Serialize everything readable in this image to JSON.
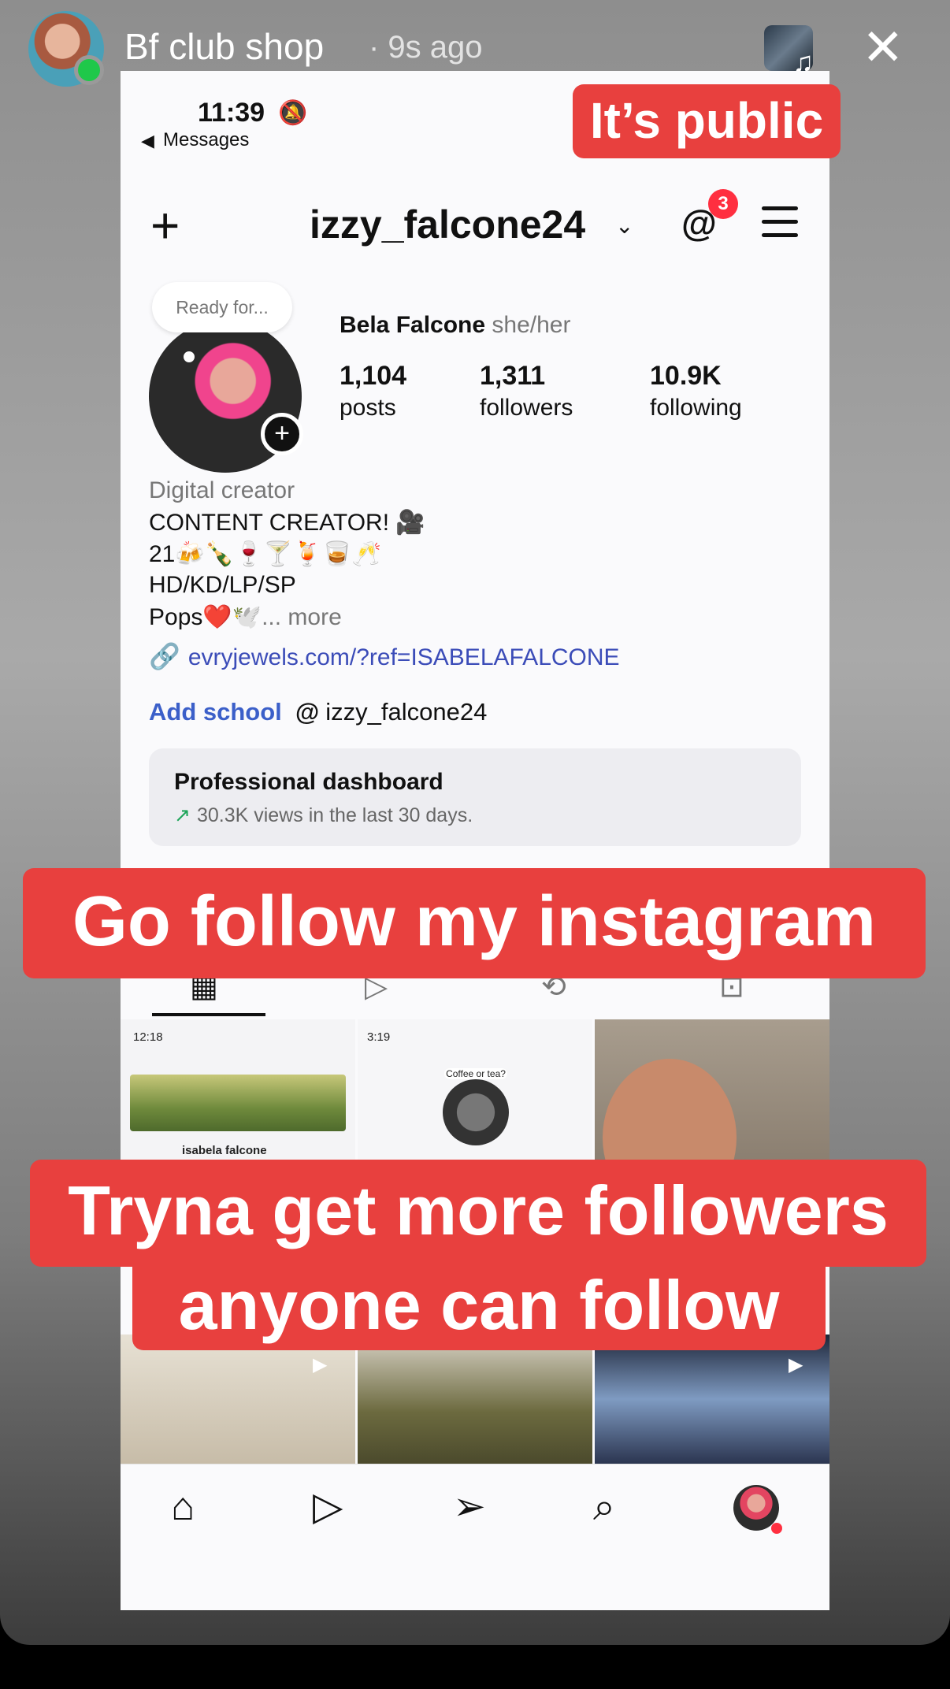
{
  "story": {
    "username": "Bf club shop",
    "time_ago": "· 9s ago"
  },
  "status_bar": {
    "time": "11:39",
    "back_label": "Messages"
  },
  "profile": {
    "handle": "izzy_falcone24",
    "notification_count": "3",
    "note": "Ready for...",
    "display_name": "Bela Falcone",
    "pronouns": "she/her",
    "posts_count": "1,104",
    "posts_label": "posts",
    "followers_count": "1,311",
    "followers_label": "followers",
    "following_count": "10.9K",
    "following_label": "following",
    "category": "Digital creator",
    "bio_lines": [
      "CONTENT CREATOR! 🎥",
      "21🍻🍾🍷🍸🍹🥃🥂",
      "HD/KD/LP/SP",
      "Pops❤️🕊️"
    ],
    "more_label": "... more",
    "link": "evryjewels.com/?ref=ISABELAFALCONE",
    "add_school": "Add school",
    "threads_handle": "izzy_falcone24"
  },
  "dashboard": {
    "title": "Professional dashboard",
    "subtitle": "30.3K views in the last 30 days."
  },
  "grid": {
    "post1_time": "12:18",
    "post1_name": "isabela falcone",
    "post2_time": "3:19",
    "post2_note": "Coffee or tea?"
  },
  "captions": {
    "public": "It’s public",
    "follow": "Go follow my instagram",
    "tryna_line1": "Tryna get more followers",
    "tryna_line2": "anyone can follow"
  },
  "icons": {
    "close": "close-icon",
    "add": "plus-icon",
    "threads": "threads-icon",
    "menu": "menu-icon",
    "home": "home-icon",
    "reels": "reels-icon",
    "direct": "paper-plane-icon",
    "search": "search-icon"
  },
  "colors": {
    "caption_red": "#e8403e",
    "link_blue": "#3b4cb8",
    "badge_red": "#ff2f40",
    "online_green": "#1fc84a"
  }
}
